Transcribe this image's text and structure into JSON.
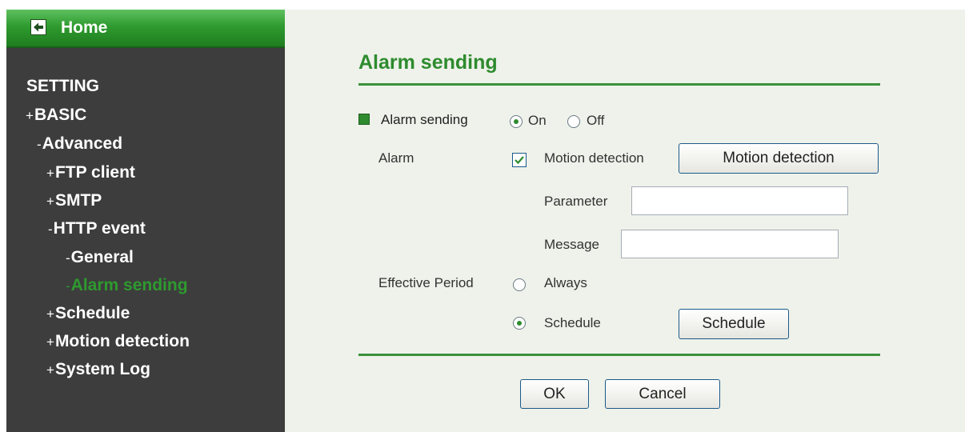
{
  "sidebar": {
    "home_label": "Home",
    "items": [
      {
        "prefix": "",
        "label": "SETTING"
      },
      {
        "prefix": "+",
        "label": "BASIC"
      },
      {
        "prefix": "-",
        "label": "Advanced"
      },
      {
        "prefix": "+",
        "label": "FTP client"
      },
      {
        "prefix": "+",
        "label": "SMTP"
      },
      {
        "prefix": "-",
        "label": "HTTP event"
      },
      {
        "prefix": "-",
        "label": "General"
      },
      {
        "prefix": "-",
        "label": "Alarm sending",
        "active": true
      },
      {
        "prefix": "+",
        "label": "Schedule"
      },
      {
        "prefix": "+",
        "label": "Motion detection"
      },
      {
        "prefix": "+",
        "label": "System Log"
      }
    ]
  },
  "main": {
    "title": "Alarm sending",
    "alarm_sending": {
      "label": "Alarm sending",
      "on_label": "On",
      "off_label": "Off",
      "selected": "On"
    },
    "alarm": {
      "label": "Alarm",
      "motion_detection_label": "Motion detection",
      "motion_detection_checked": true,
      "motion_detection_button": "Motion detection",
      "parameter_label": "Parameter",
      "parameter_value": "",
      "message_label": "Message",
      "message_value": ""
    },
    "effective_period": {
      "label": "Effective Period",
      "always_label": "Always",
      "schedule_label": "Schedule",
      "selected": "Schedule",
      "schedule_button": "Schedule"
    },
    "ok_button": "OK",
    "cancel_button": "Cancel"
  },
  "colors": {
    "accent_green": "#2e8b2e",
    "sidebar_bg": "#3d3d3d",
    "main_bg": "#eef2ea"
  }
}
